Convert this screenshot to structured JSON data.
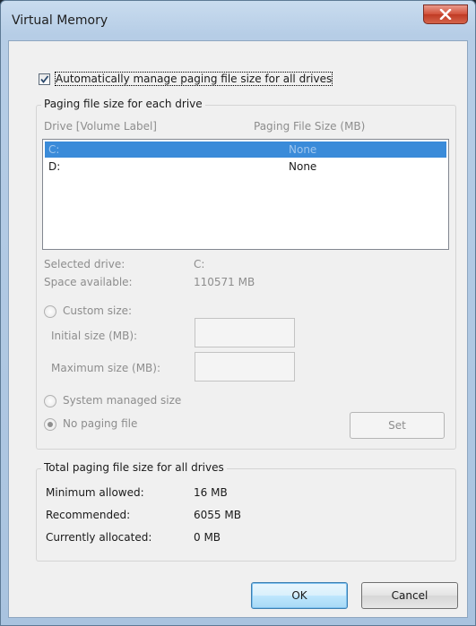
{
  "window": {
    "title": "Virtual Memory"
  },
  "auto_manage": {
    "label": "Automatically manage paging file size for all drives",
    "checked": true
  },
  "paging_group": {
    "title": "Paging file size for each drive",
    "col_drive": "Drive  [Volume Label]",
    "col_size": "Paging File Size (MB)",
    "drives": [
      {
        "drive": "C:",
        "size": "None",
        "selected": true
      },
      {
        "drive": "D:",
        "size": "None",
        "selected": false
      }
    ],
    "selected_drive_label": "Selected drive:",
    "selected_drive_value": "C:",
    "space_available_label": "Space available:",
    "space_available_value": "110571 MB",
    "custom_size_label": "Custom size:",
    "initial_size_label": "Initial size (MB):",
    "initial_size_value": "",
    "maximum_size_label": "Maximum size (MB):",
    "maximum_size_value": "",
    "system_managed_label": "System managed size",
    "no_paging_label": "No paging file",
    "set_label": "Set"
  },
  "total_group": {
    "title": "Total paging file size for all drives",
    "minimum_label": "Minimum allowed:",
    "minimum_value": "16 MB",
    "recommended_label": "Recommended:",
    "recommended_value": "6055 MB",
    "allocated_label": "Currently allocated:",
    "allocated_value": "0 MB"
  },
  "buttons": {
    "ok": "OK",
    "cancel": "Cancel"
  },
  "icons": {
    "close": "close-icon",
    "check": "checkmark-icon"
  },
  "colors": {
    "selection": "#3a8bd9",
    "close_button": "#c9452e",
    "disabled_text": "#8d8d8d"
  }
}
